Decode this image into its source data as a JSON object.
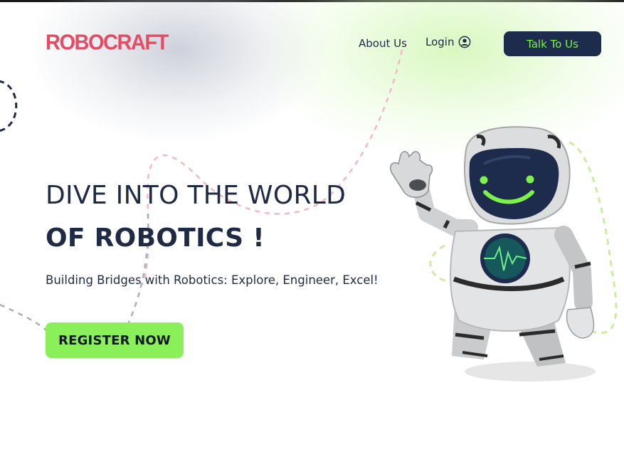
{
  "brand": {
    "logo_text": "ROBOCRAFT"
  },
  "nav": {
    "about_label": "About Us",
    "login_label": "Login",
    "login_icon": "user-circle-icon",
    "cta_label": "Talk To Us"
  },
  "hero": {
    "title_line1": "DIVE INTO THE WORLD",
    "title_line2_prefix": "OF ",
    "title_line2_strong": "ROBOTICS !",
    "subtitle": "Building Bridges with Robotics: Explore, Engineer, Excel!",
    "register_label": "REGISTER NOW"
  },
  "illustration": {
    "icon": "waving-robot-illustration"
  },
  "colors": {
    "brand": "#e84a63",
    "navy": "#1d2b4c",
    "accent_green": "#8af05a",
    "cta_text": "#7ef24a",
    "text": "#1f2b45"
  }
}
